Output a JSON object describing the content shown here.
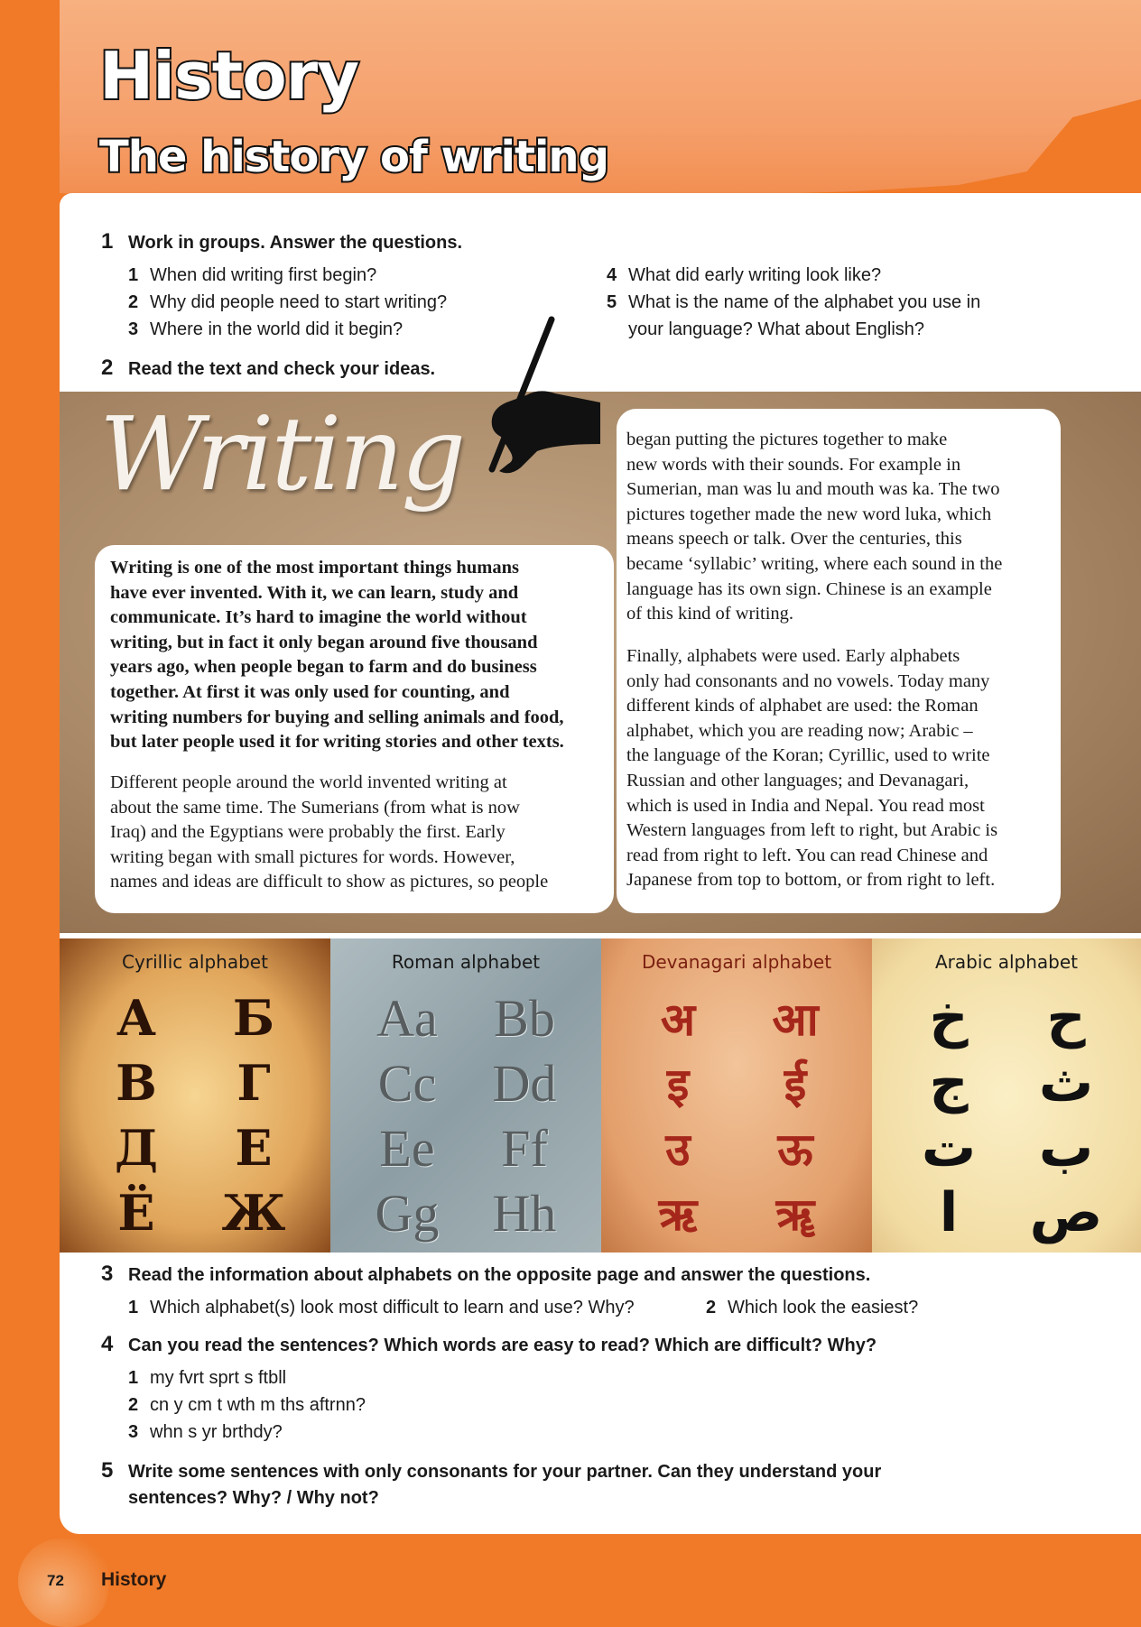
{
  "header": {
    "title": "History",
    "subtitle": "The history of writing"
  },
  "exercise1": {
    "number": "1",
    "heading": "Work in groups. Answer the questions.",
    "questions": [
      {
        "n": "1",
        "text": "When did writing first begin?"
      },
      {
        "n": "2",
        "text": "Why did people need to start writing?"
      },
      {
        "n": "3",
        "text": "Where in the world did it begin?"
      },
      {
        "n": "4",
        "text": "What did early writing look like?"
      },
      {
        "n": "5",
        "text": "What is the name of the alphabet you use in",
        "text2": "your language? What about English?"
      }
    ]
  },
  "exercise2": {
    "number": "2",
    "heading": "Read the text and check your ideas."
  },
  "reading": {
    "title": "Writing",
    "left_bold": [
      "Writing is one of the most important things humans",
      "have ever invented. With it, we can learn, study and",
      "communicate. It’s hard to imagine the world without",
      "writing, but in fact it only began around five thousand",
      "years ago, when people began to farm and do business",
      "together. At first it was only used for counting, and",
      "writing numbers for buying and selling animals and food,",
      "but later people used it for writing stories and other texts."
    ],
    "left_normal": [
      "Different people around the world invented writing at",
      "about the same time. The Sumerians (from what is now",
      "Iraq) and the Egyptians were probably the first. Early",
      "writing began with small pictures for words. However,",
      "names and ideas are difficult to show as pictures, so people"
    ],
    "right_para1": [
      "began putting the pictures together to make",
      "new words with their sounds. For example in",
      "Sumerian, man was lu and mouth was ka. The two",
      "pictures together made the new word luka, which",
      "means speech or talk. Over the centuries, this",
      "became ‘syllabic’ writing, where each sound in the",
      "language has its own sign. Chinese is an example",
      "of this kind of writing."
    ],
    "right_para2": [
      "Finally, alphabets were used. Early alphabets",
      "only had consonants and no vowels. Today many",
      "different kinds of alphabet are used: the Roman",
      "alphabet, which you are reading now; Arabic –",
      "the language of the Koran; Cyrillic, used to write",
      "Russian and other languages; and Devanagari,",
      "which is used in India and Nepal. You read most",
      "Western languages from left to right, but Arabic is",
      "read from right to left. You can read Chinese and",
      "Japanese from top to bottom, or from right to left."
    ]
  },
  "alphabets": [
    {
      "title": "Cyrillic alphabet",
      "letters": [
        "А",
        "Б",
        "В",
        "Г",
        "Д",
        "Е",
        "Ё",
        "Ж"
      ]
    },
    {
      "title": "Roman alphabet",
      "letters": [
        "Aa",
        "Bb",
        "Cc",
        "Dd",
        "Ee",
        "Ff",
        "Gg",
        "Hh"
      ]
    },
    {
      "title": "Devanagari alphabet",
      "letters": [
        "अ",
        "आ",
        "इ",
        "ई",
        "उ",
        "ऊ",
        "ऋ",
        "ॠ"
      ]
    },
    {
      "title": "Arabic alphabet",
      "letters": [
        "خ",
        "ح",
        "ج",
        "ث",
        "ت",
        "ب",
        "ا",
        "ص"
      ]
    }
  ],
  "exercise3": {
    "number": "3",
    "heading": "Read the information about alphabets on the opposite page and answer the questions.",
    "questions": [
      {
        "n": "1",
        "text": "Which alphabet(s) look most difficult to learn and use? Why?"
      },
      {
        "n": "2",
        "text": "Which look the easiest?"
      }
    ]
  },
  "exercise4": {
    "number": "4",
    "heading": "Can you read the sentences? Which words are easy to read? Which are difficult? Why?",
    "questions": [
      {
        "n": "1",
        "text": "my fvrt sprt s ftbll"
      },
      {
        "n": "2",
        "text": "cn y cm t wth m ths aftrnn?"
      },
      {
        "n": "3",
        "text": "whn s yr brthdy?"
      }
    ]
  },
  "exercise5": {
    "number": "5",
    "heading_line1": "Write some sentences with only consonants for your partner. Can they understand your",
    "heading_line2": "sentences? Why? / Why not?"
  },
  "footer": {
    "page_number": "72",
    "section": "History"
  },
  "colors": {
    "accent_orange": "#f07a28",
    "header_orange": "#f5a06c"
  }
}
